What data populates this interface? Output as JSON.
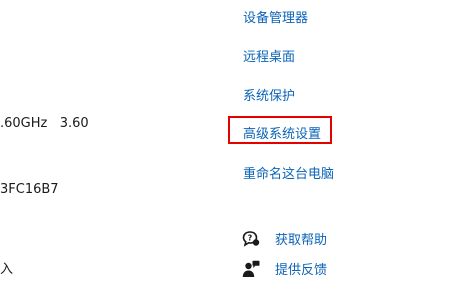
{
  "system_info_partial": {
    "processor_speed": ".60GHz   3.60",
    "product_id_fragment": "3FC16B7",
    "pen_touch_fragment": "入"
  },
  "related_links": {
    "device_manager": "设备管理器",
    "remote_desktop": "远程桌面",
    "system_protection": "系统保护",
    "advanced_settings": "高级系统设置",
    "rename_pc": "重命名这台电脑"
  },
  "support": {
    "get_help": "获取帮助",
    "give_feedback": "提供反馈",
    "get_help_icon": "help-chat-icon",
    "give_feedback_icon": "feedback-person-icon"
  },
  "colors": {
    "link": "#0b63b7",
    "highlight": "#e60000",
    "text": "#1a1a1a"
  }
}
